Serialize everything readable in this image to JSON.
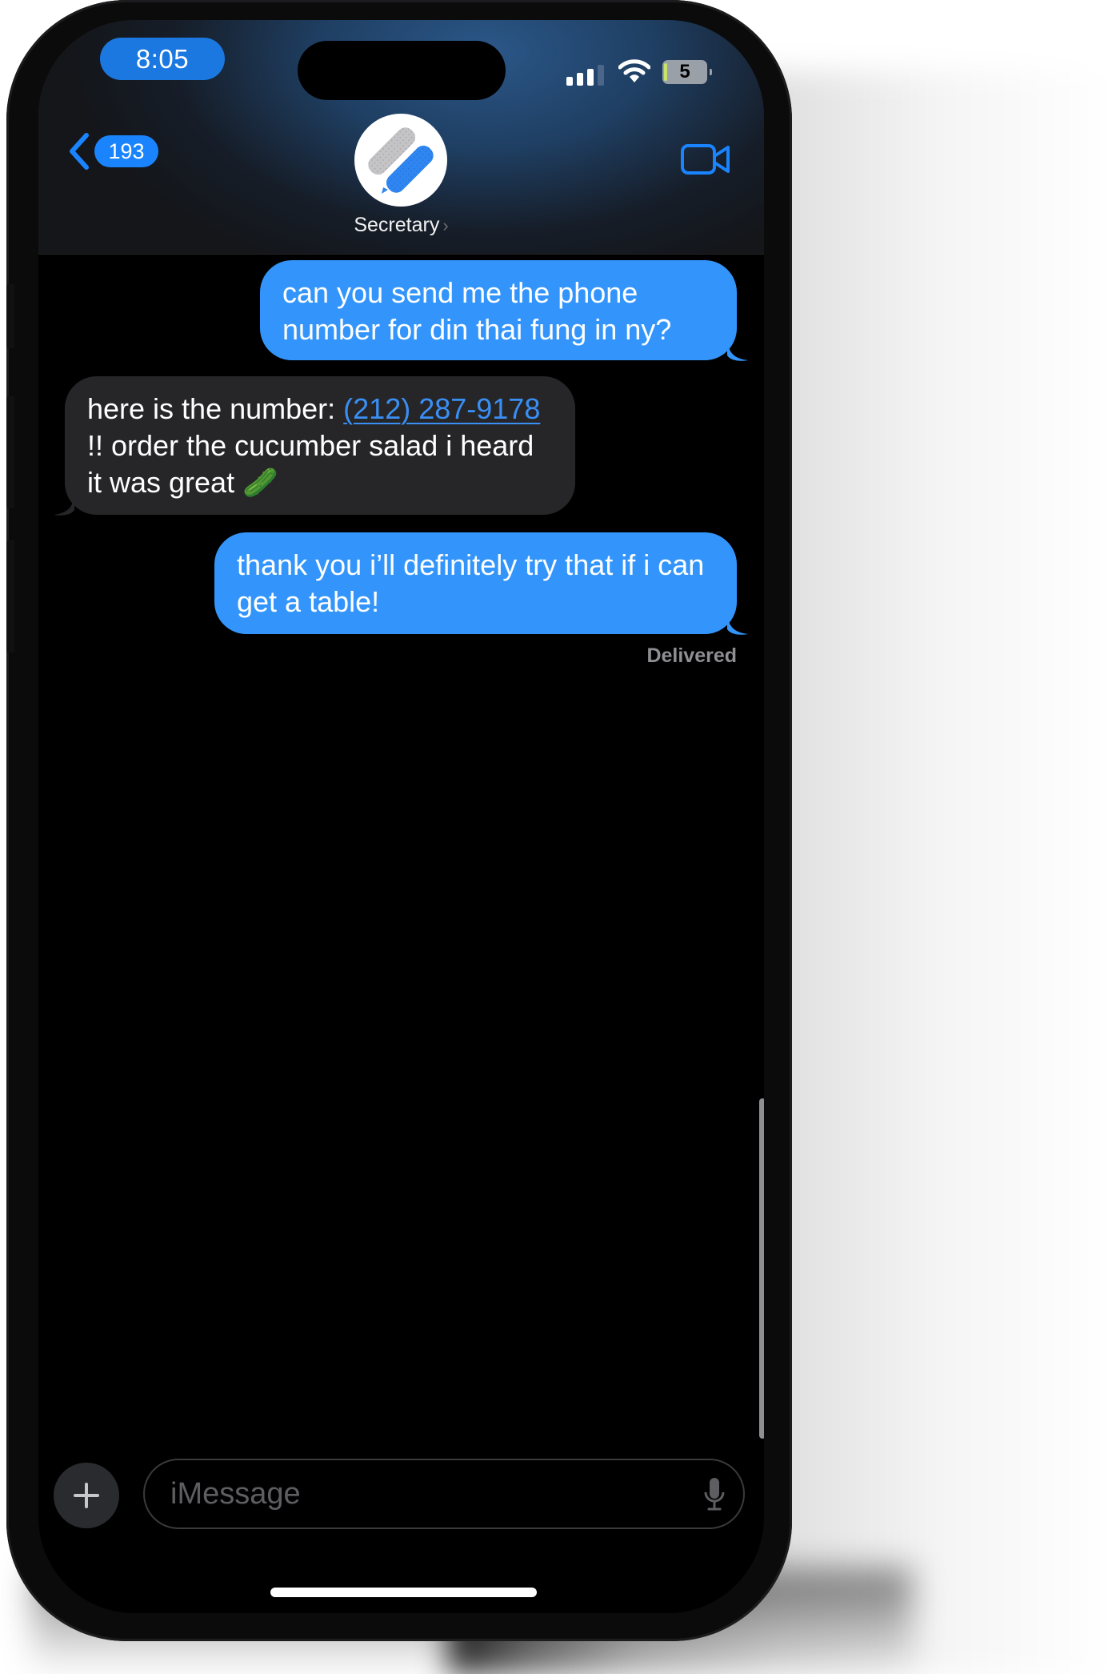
{
  "status_bar": {
    "time": "8:05",
    "signal_bars": 3,
    "signal_bars_total": 4,
    "wifi": "wifi-icon",
    "battery_percent": "5"
  },
  "header": {
    "back_count": "193",
    "contact_name": "Secretary",
    "contact_chevron": "›",
    "video_icon": "video-camera-icon"
  },
  "messages": [
    {
      "direction": "outgoing",
      "text": "can you send me the phone number for din thai fung in ny?"
    },
    {
      "direction": "incoming",
      "text_before": "here is the number: ",
      "link": "(212) 287-9178",
      "text_after": " !! order the cucumber salad i heard it was great ",
      "emoji": "🥒"
    },
    {
      "direction": "outgoing",
      "text": "thank you i’ll definitely try that if i can get a table!"
    }
  ],
  "delivery_status": "Delivered",
  "composer": {
    "placeholder": "iMessage",
    "value": "",
    "plus_icon": "plus-icon",
    "mic_icon": "microphone-icon"
  },
  "colors": {
    "accent": "#1a84ff",
    "outgoing_bubble": "#3395fb",
    "incoming_bubble": "#262628",
    "link": "#3a8ff5"
  }
}
